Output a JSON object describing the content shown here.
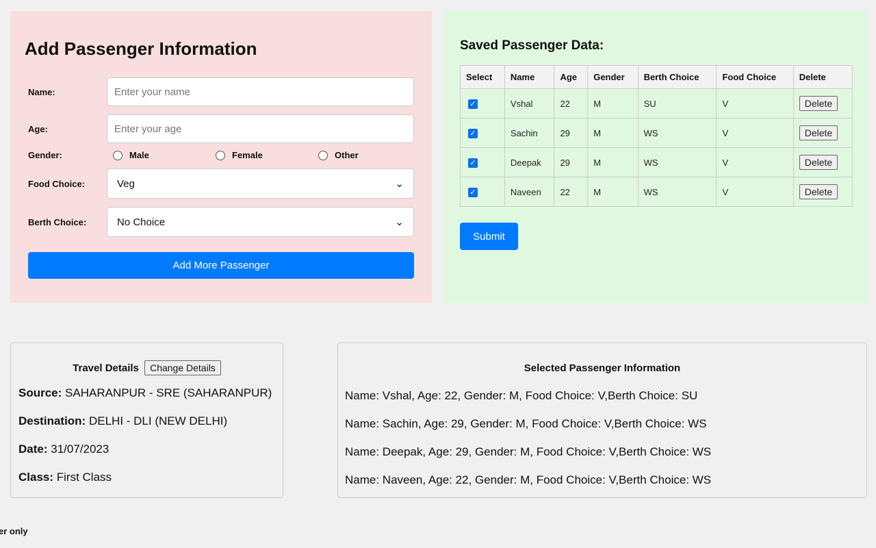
{
  "form": {
    "title": "Add Passenger Information",
    "name_label": "Name:",
    "name_placeholder": "Enter your name",
    "age_label": "Age:",
    "age_placeholder": "Enter your age",
    "gender_label": "Gender:",
    "gender_options": [
      "Male",
      "Female",
      "Other"
    ],
    "food_label": "Food Choice:",
    "food_value": "Veg",
    "berth_label": "Berth Choice:",
    "berth_value": "No Choice",
    "add_button": "Add More Passenger"
  },
  "saved": {
    "title": "Saved Passenger Data:",
    "columns": [
      "Select",
      "Name",
      "Age",
      "Gender",
      "Berth Choice",
      "Food Choice",
      "Delete"
    ],
    "rows": [
      {
        "name": "Vshal",
        "age": "22",
        "gender": "M",
        "berth": "SU",
        "food": "V",
        "checked": true
      },
      {
        "name": "Sachin",
        "age": "29",
        "gender": "M",
        "berth": "WS",
        "food": "V",
        "checked": true
      },
      {
        "name": "Deepak",
        "age": "29",
        "gender": "M",
        "berth": "WS",
        "food": "V",
        "checked": true
      },
      {
        "name": "Naveen",
        "age": "22",
        "gender": "M",
        "berth": "WS",
        "food": "V",
        "checked": true
      }
    ],
    "delete_label": "Delete",
    "submit": "Submit"
  },
  "travel": {
    "title": "Travel Details",
    "change_button": "Change Details",
    "items": [
      {
        "label": "Source:",
        "value": "SAHARANPUR - SRE (SAHARANPUR)"
      },
      {
        "label": "Destination:",
        "value": "DELHI - DLI (NEW DELHI)"
      },
      {
        "label": "Date:",
        "value": "31/07/2023"
      },
      {
        "label": "Class:",
        "value": "First Class"
      }
    ]
  },
  "selected": {
    "title": "Selected Passenger Information",
    "lines": [
      "Name: Vshal, Age: 22, Gender: M, Food Choice: V,Berth Choice: SU",
      "Name: Sachin, Age: 29, Gender: M, Food Choice: V,Berth Choice: WS",
      "Name: Deepak, Age: 29, Gender: M, Food Choice: V,Berth Choice: WS",
      "Name: Naveen, Age: 22, Gender: M, Food Choice: V,Berth Choice: WS"
    ]
  },
  "footer": {
    "text": "er only"
  },
  "colors": {
    "primary": "#007bff",
    "form_bg": "#f8dede",
    "saved_bg": "#e0f8e0"
  }
}
